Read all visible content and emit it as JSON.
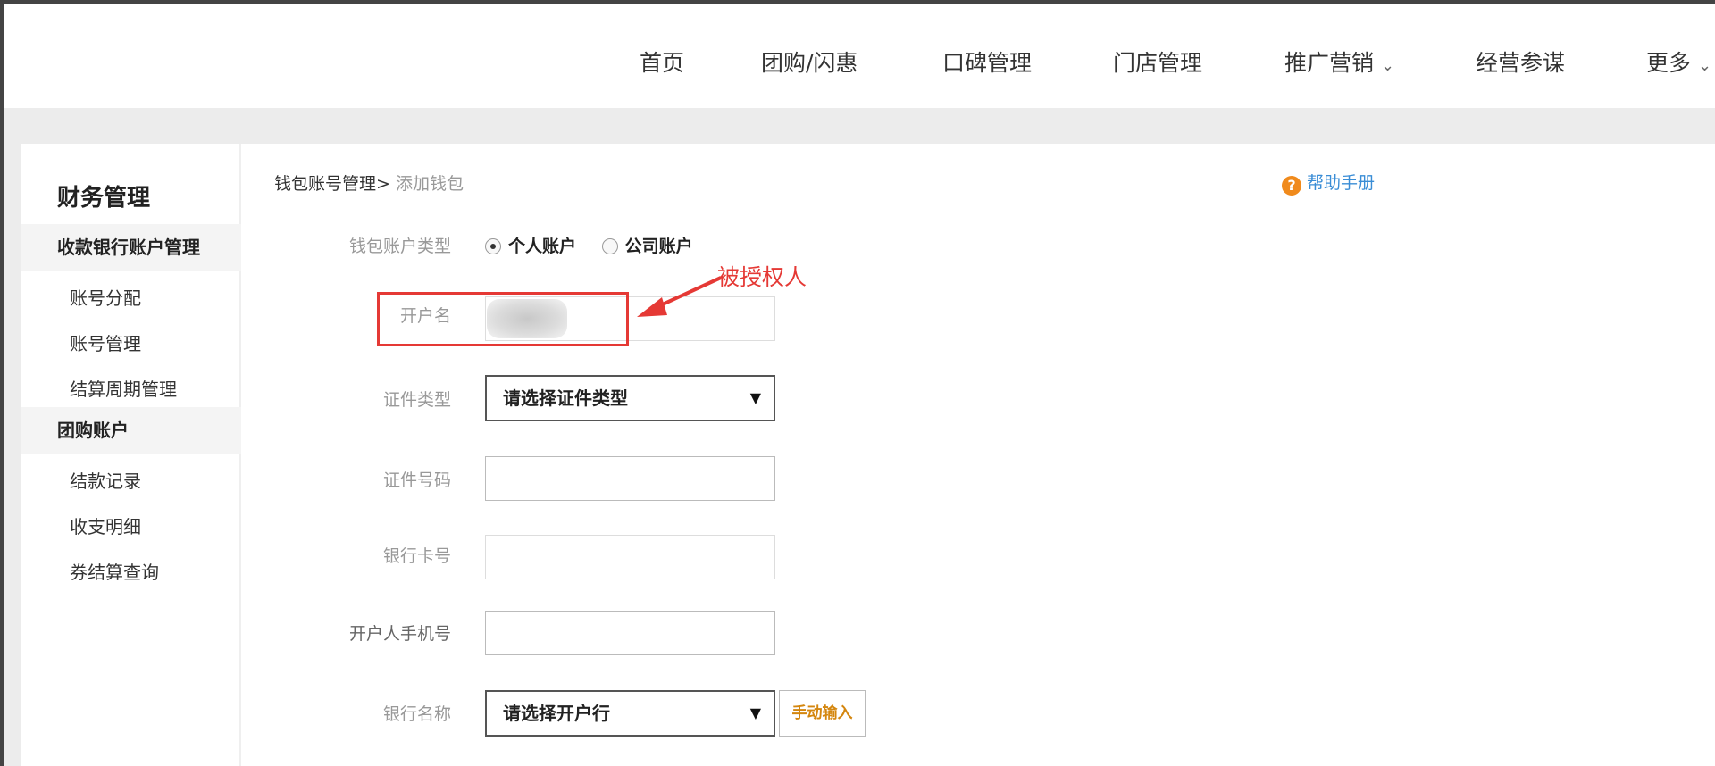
{
  "nav": {
    "items": [
      "首页",
      "团购/闪惠",
      "口碑管理",
      "门店管理",
      "推广营销",
      "经营参谋",
      "更多"
    ]
  },
  "sidebar": {
    "title": "财务管理",
    "group1": "收款银行账户管理",
    "group1_items": [
      "账号分配",
      "账号管理",
      "结算周期管理"
    ],
    "group2": "团购账户",
    "group2_items": [
      "结款记录",
      "收支明细",
      "券结算查询"
    ]
  },
  "breadcrumb": {
    "parent": "钱包账号管理>",
    "current": "添加钱包"
  },
  "help": {
    "label": "帮助手册",
    "icon": "question-icon"
  },
  "form": {
    "account_type_label": "钱包账户类型",
    "account_type_options": [
      "个人账户",
      "公司账户"
    ],
    "account_type_selected": "个人账户",
    "account_name_label": "开户名",
    "id_type_label": "证件类型",
    "id_type_selected": "请选择证件类型",
    "id_number_label": "证件号码",
    "bank_card_label": "银行卡号",
    "phone_label": "开户人手机号",
    "bank_name_label": "银行名称",
    "bank_name_selected": "请选择开户行",
    "manual_input_label": "手动输入"
  },
  "annotation": {
    "text": "被授权人",
    "color": "#e53935"
  }
}
